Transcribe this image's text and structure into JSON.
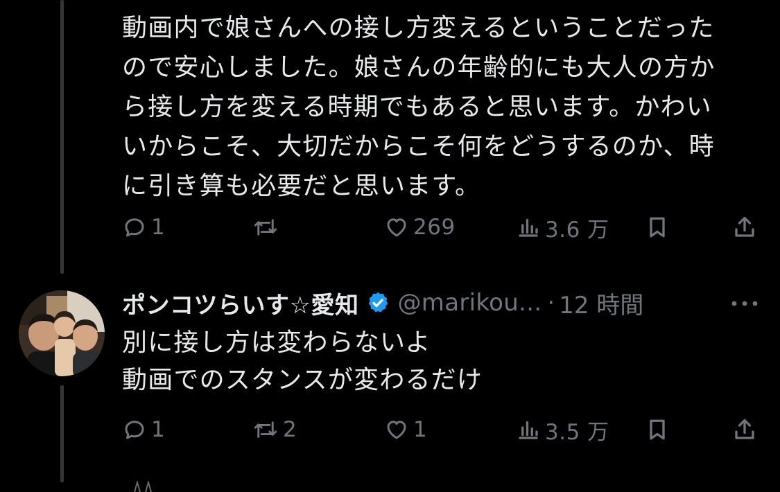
{
  "colors": {
    "background": "#000000",
    "text": "#e7e9ea",
    "muted": "#71767b",
    "thread_line": "#333639",
    "verified_badge": "#1d9bf0"
  },
  "tweet1": {
    "text": "動画内で娘さんへの接し方変えるということだった\nので安心しました。娘さんの年齢的にも大人の方か\nら接し方を変える時期でもあると思います。かわい\nいからこそ、大切だからこそ何をどうするのか、時\nに引き算も必要だと思います。",
    "actions": {
      "reply_icon": "reply-icon",
      "reply_count": "1",
      "retweet_icon": "retweet-icon",
      "retweet_count": "",
      "like_icon": "heart-icon",
      "like_count": "269",
      "views_icon": "views-icon",
      "views_count": "3.6 万",
      "bookmark_icon": "bookmark-icon",
      "share_icon": "share-icon"
    }
  },
  "tweet2": {
    "author_name": "ポンコツらいす☆愛知",
    "verified_icon": "verified-badge-icon",
    "handle": "@marikou...",
    "separator": "·",
    "time": "12 時間",
    "more_icon": "more-icon",
    "text": "別に接し方は変わらないよ\n動画でのスタンスが変わるだけ",
    "actions": {
      "reply_icon": "reply-icon",
      "reply_count": "1",
      "retweet_icon": "retweet-icon",
      "retweet_count": "2",
      "like_icon": "heart-icon",
      "like_count": "1",
      "views_icon": "views-icon",
      "views_count": "3.5 万",
      "bookmark_icon": "bookmark-icon",
      "share_icon": "share-icon"
    }
  }
}
